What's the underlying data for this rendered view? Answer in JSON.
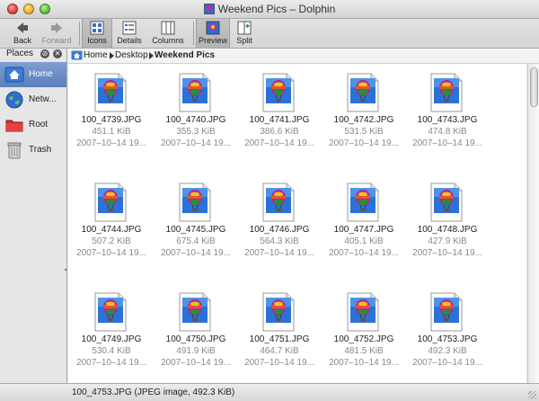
{
  "window": {
    "title": "Weekend Pics – Dolphin"
  },
  "toolbar": {
    "back": "Back",
    "forward": "Forward",
    "icons": "Icons",
    "details": "Details",
    "columns": "Columns",
    "preview": "Preview",
    "split": "Split"
  },
  "places": {
    "title": "Places",
    "items": [
      {
        "label": "Home",
        "icon": "home-icon"
      },
      {
        "label": "Netw...",
        "icon": "globe-icon"
      },
      {
        "label": "Root",
        "icon": "folder-red-icon"
      },
      {
        "label": "Trash",
        "icon": "trash-icon"
      }
    ]
  },
  "breadcrumb": {
    "home": "Home",
    "desktop": "Desktop",
    "current": "Weekend Pics"
  },
  "files": [
    {
      "name": "100_4739.JPG",
      "size": "451.1 KiB",
      "date": "2007–10–14 19..."
    },
    {
      "name": "100_4740.JPG",
      "size": "355.3 KiB",
      "date": "2007–10–14 19..."
    },
    {
      "name": "100_4741.JPG",
      "size": "386.6 KiB",
      "date": "2007–10–14 19..."
    },
    {
      "name": "100_4742.JPG",
      "size": "531.5 KiB",
      "date": "2007–10–14 19..."
    },
    {
      "name": "100_4743.JPG",
      "size": "474.8 KiB",
      "date": "2007–10–14 19..."
    },
    {
      "name": "100_4744.JPG",
      "size": "507.2 KiB",
      "date": "2007–10–14 19..."
    },
    {
      "name": "100_4745.JPG",
      "size": "675.4 KiB",
      "date": "2007–10–14 19..."
    },
    {
      "name": "100_4746.JPG",
      "size": "564.3 KiB",
      "date": "2007–10–14 19..."
    },
    {
      "name": "100_4747.JPG",
      "size": "405.1 KiB",
      "date": "2007–10–14 19..."
    },
    {
      "name": "100_4748.JPG",
      "size": "427.9 KiB",
      "date": "2007–10–14 19..."
    },
    {
      "name": "100_4749.JPG",
      "size": "530.4 KiB",
      "date": "2007–10–14 19..."
    },
    {
      "name": "100_4750.JPG",
      "size": "491.9 KiB",
      "date": "2007–10–14 19..."
    },
    {
      "name": "100_4751.JPG",
      "size": "464.7 KiB",
      "date": "2007–10–14 19..."
    },
    {
      "name": "100_4752.JPG",
      "size": "481.5 KiB",
      "date": "2007–10–14 19..."
    },
    {
      "name": "100_4753.JPG",
      "size": "492.3 KiB",
      "date": "2007–10–14 19..."
    }
  ],
  "status": {
    "text": "100_4753.JPG (JPEG image, 492.3 KiB)"
  }
}
